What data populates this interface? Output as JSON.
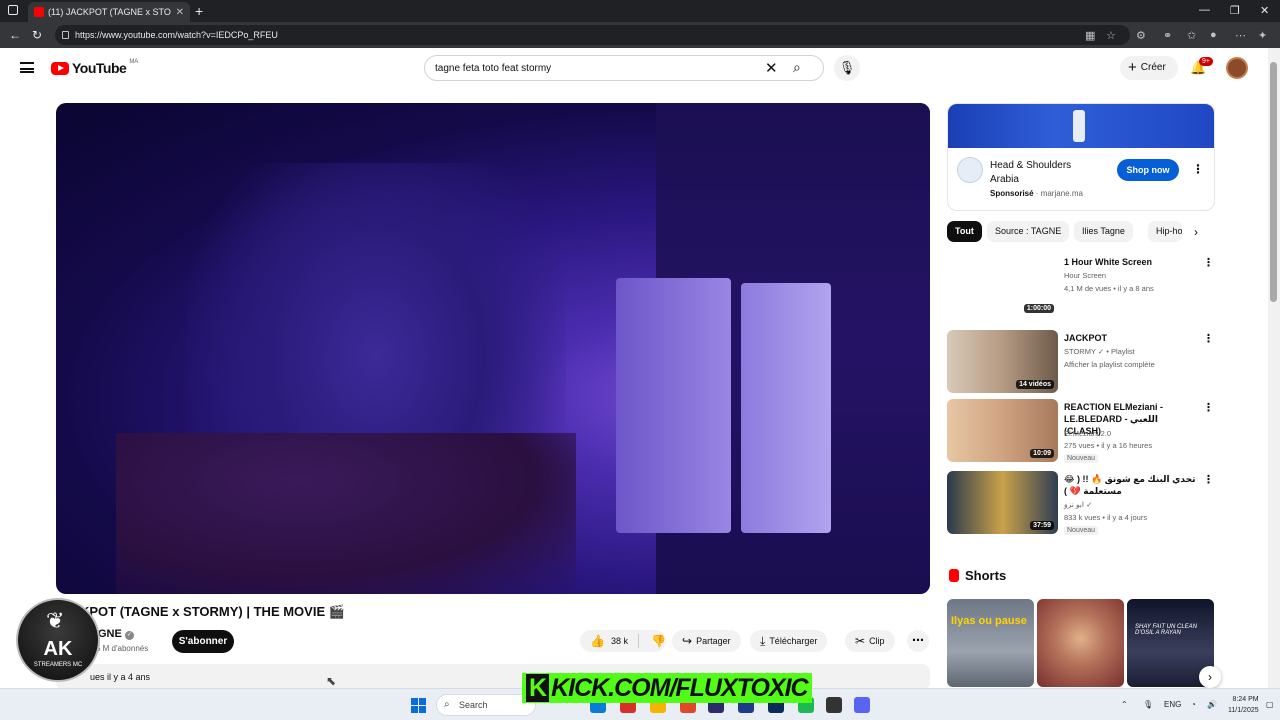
{
  "browser": {
    "tab_title": "(11) JACKPOT (TAGNE x STO",
    "url": "https://www.youtube.com/watch?v=IEDCPo_RFEU"
  },
  "header": {
    "logo_text": "YouTube",
    "logo_country": "MA",
    "search_value": "tagne feta toto feat stormy",
    "create_label": "Créer",
    "notif_count": "9+"
  },
  "video": {
    "title": "KPOT (TAGNE x STORMY) | THE MOVIE 🎬",
    "channel": "AGNE",
    "subscribers": "5 M d'abonnés",
    "subscribe_label": "S'abonner",
    "likes": "38 k",
    "share_label": "Partager",
    "download_label": "Télécharger",
    "clip_label": "Clip",
    "views_text": "ues  il y a 4 ans"
  },
  "watermark": {
    "title": "AK",
    "subtitle": "STREAMERS MC"
  },
  "ad": {
    "advertiser": "Head & Shoulders Arabia",
    "sponsored_label": "Sponsorisé",
    "domain": "marjane.ma",
    "cta": "Shop now"
  },
  "chips": [
    "Tout",
    "Source : TAGNE",
    "Ilies Tagne",
    "Hip-hop"
  ],
  "recommendations": [
    {
      "title": "1 Hour White Screen",
      "channel": "Hour Screen",
      "meta": "4,1 M de vues • il y a 8 ans",
      "duration": "1:00:00",
      "badge": ""
    },
    {
      "title": "JACKPOT",
      "channel": "STORMY ✓ • Playlist",
      "meta": "Afficher la playlist complète",
      "duration": "14 vidéos",
      "badge": ""
    },
    {
      "title": "REACTION ELMeziani - LE.BLEDARD - اللعبي (CLASH)",
      "channel": "El.Meziani 2.0",
      "meta": "275 vues • il y a 16 heures",
      "duration": "10:09",
      "badge": "Nouveau"
    },
    {
      "title": "😂 تحدي البنك مع شونق 🔥 !! ( مستعلمة 💔 )",
      "channel": "ابو نزو ✓",
      "meta": "833 k vues • il y a 4 jours",
      "duration": "37:59",
      "badge": "Nouveau"
    }
  ],
  "shorts": {
    "heading": "Shorts",
    "items": [
      {
        "caption": "Ilyas ou pause"
      },
      {
        "caption": ""
      },
      {
        "caption": "SHAY FAIT UN CLEAN D'OSIL A RAYAN"
      }
    ]
  },
  "overlay": {
    "kick_text": "KICK.COM/FLUXTOXIC"
  },
  "taskbar": {
    "search_placeholder": "Search",
    "lang": "ENG",
    "time": "8:24 PM",
    "date": "11/1/2025"
  }
}
